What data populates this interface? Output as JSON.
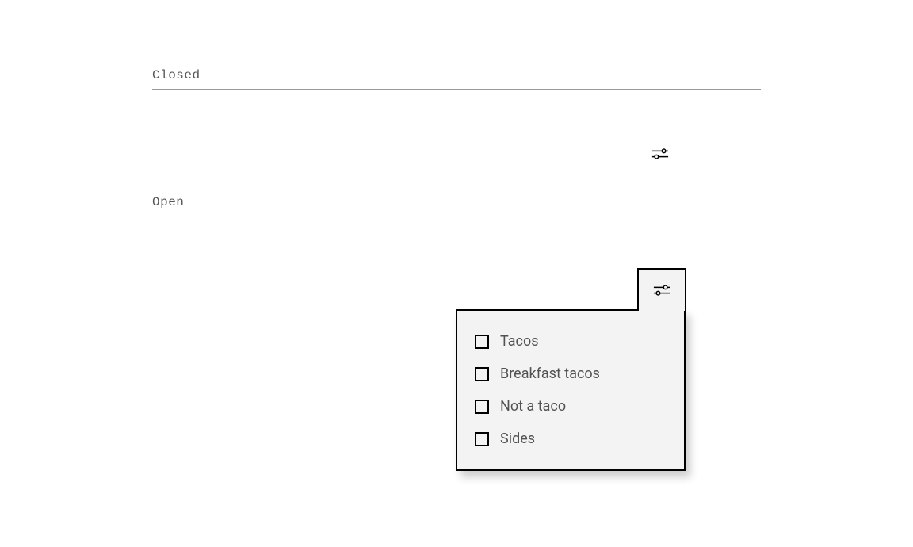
{
  "sections": {
    "closed_label": "Closed",
    "open_label": "Open"
  },
  "panel": {
    "options": [
      {
        "label": "Tacos"
      },
      {
        "label": "Breakfast tacos"
      },
      {
        "label": "Not a taco"
      },
      {
        "label": "Sides"
      }
    ]
  }
}
